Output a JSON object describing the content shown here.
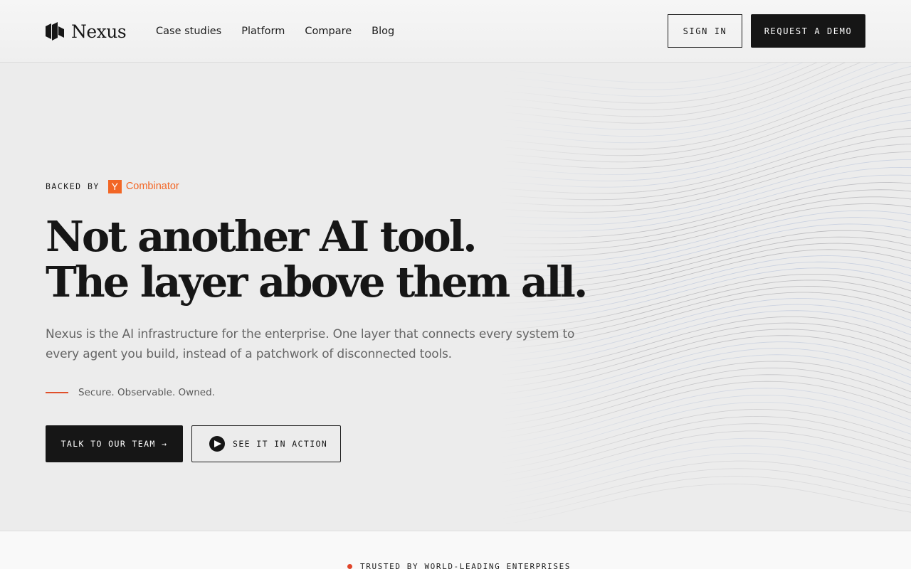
{
  "brand": {
    "name": "Nexus",
    "logo_icon": "nexus-logo-icon"
  },
  "nav": {
    "items": [
      {
        "label": "Case studies"
      },
      {
        "label": "Platform"
      },
      {
        "label": "Compare"
      },
      {
        "label": "Blog"
      }
    ]
  },
  "header_actions": {
    "sign_in": "SIGN IN",
    "request_demo": "REQUEST A DEMO"
  },
  "hero": {
    "backed_by_label": "BACKED BY",
    "backer": {
      "mark": "Y",
      "name": "Combinator",
      "color": "#f26625"
    },
    "headline": {
      "line1": "Not another AI tool.",
      "line2": "The layer above them all."
    },
    "subtext": "Nexus is the AI infrastructure for the enterprise. One layer that connects every system to every agent you build, instead of a patchwork of disconnected tools.",
    "tagline": "Secure. Observable. Owned.",
    "primary_cta": "TALK TO OUR TEAM →",
    "secondary_cta": "SEE IT IN ACTION",
    "secondary_cta_icon": "play-icon",
    "art_icon": "wave-lines-art",
    "accent_color": "#e0502a"
  },
  "trusted": {
    "label": "TRUSTED BY WORLD-LEADING ENTERPRISES",
    "dot_color": "#e0452a"
  }
}
